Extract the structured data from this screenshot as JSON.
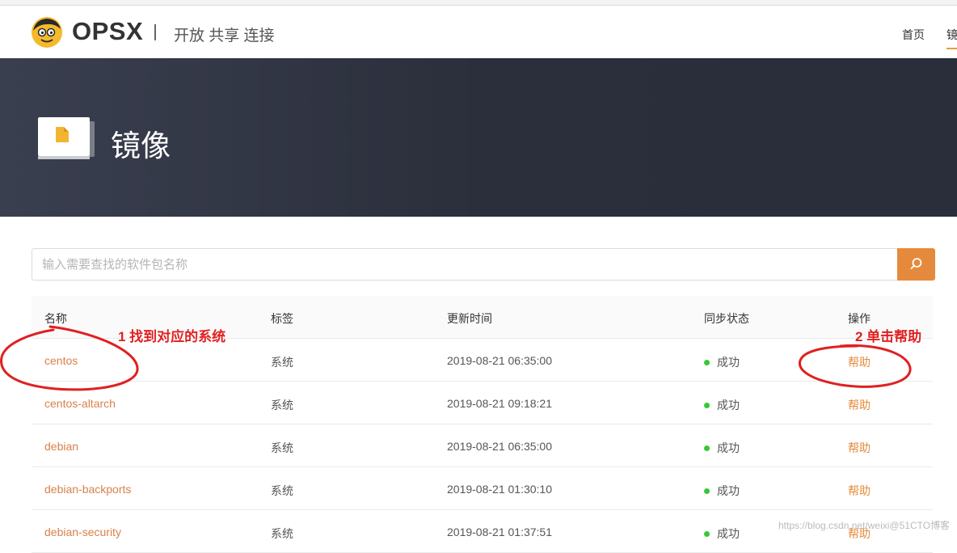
{
  "header": {
    "brand": "OPSX",
    "slogan": "开放 共享 连接",
    "nav": {
      "home": "首页",
      "mirror": "镜像"
    },
    "logo_icon": "mascot-face-icon"
  },
  "banner": {
    "title": "镜像",
    "icon": "document-stack-icon"
  },
  "search": {
    "placeholder": "输入需要查找的软件包名称",
    "value": "",
    "button_icon": "search-icon"
  },
  "table": {
    "headers": {
      "name": "名称",
      "tag": "标签",
      "updated": "更新时间",
      "status": "同步状态",
      "action": "操作"
    },
    "rows": [
      {
        "name": "centos",
        "tag": "系统",
        "updated": "2019-08-21 06:35:00",
        "status": "成功",
        "action": "帮助"
      },
      {
        "name": "centos-altarch",
        "tag": "系统",
        "updated": "2019-08-21 09:18:21",
        "status": "成功",
        "action": "帮助"
      },
      {
        "name": "debian",
        "tag": "系统",
        "updated": "2019-08-21 06:35:00",
        "status": "成功",
        "action": "帮助"
      },
      {
        "name": "debian-backports",
        "tag": "系统",
        "updated": "2019-08-21 01:30:10",
        "status": "成功",
        "action": "帮助"
      },
      {
        "name": "debian-security",
        "tag": "系统",
        "updated": "2019-08-21 01:37:51",
        "status": "成功",
        "action": "帮助"
      }
    ]
  },
  "annotations": {
    "step1": "1 找到对应的系统",
    "step2": "2 单击帮助"
  },
  "watermark": "https://blog.csdn.net/weixi@51CTO博客",
  "colors": {
    "accent": "#e58a3c",
    "link": "#d9814a",
    "success": "#35c935",
    "banner_bg": "#2b2f3b",
    "annotation": "#e02020"
  }
}
